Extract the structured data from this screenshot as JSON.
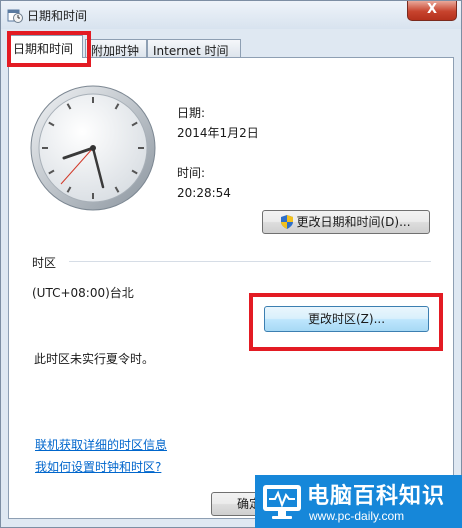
{
  "window": {
    "title": "日期和时间",
    "close_label": "X"
  },
  "tabs": [
    {
      "label": "日期和时间",
      "active": true
    },
    {
      "label": "附加时钟",
      "active": false
    },
    {
      "label": "Internet 时间",
      "active": false
    }
  ],
  "datetime": {
    "date_label": "日期:",
    "date_value": "2014年1月2日",
    "time_label": "时间:",
    "time_value": "20:28:54",
    "change_button": "更改日期和时间(D)..."
  },
  "timezone": {
    "heading": "时区",
    "value": "(UTC+08:00)台北",
    "change_button": "更改时区(Z)...",
    "dst_note": "此时区未实行夏令时。"
  },
  "links": [
    "联机获取详细的时区信息",
    "我如何设置时钟和时区?"
  ],
  "footer": {
    "ok_button": "确定"
  },
  "watermark": {
    "title": "电脑百科知识",
    "url": "www.pc-daily.com"
  },
  "colors": {
    "highlight": "#e31b23",
    "link": "#0066cc",
    "watermark_bg": "#1687d9"
  }
}
